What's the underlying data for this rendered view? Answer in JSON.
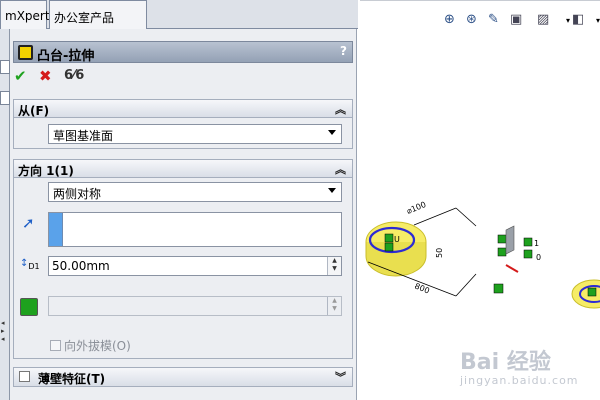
{
  "tabs": {
    "mxpert": "mXpert",
    "office": "办公室产品"
  },
  "feature": {
    "title": "凸台-拉伸",
    "help": "?"
  },
  "actions": {
    "ok": "✔",
    "cancel": "✖",
    "preview": "6⁄6"
  },
  "from_group": {
    "title": "从(F)",
    "value": "草图基准面"
  },
  "direction1": {
    "title": "方向 1(1)",
    "end_condition": "两侧对称",
    "depth": "50.00mm",
    "depth_icon_label": "D1",
    "draft_outward": "向外拔模(O)"
  },
  "thin_feature": {
    "title": "薄壁特征(T)"
  },
  "dimensions": {
    "dia": "⌀100",
    "width": "800",
    "small": "50"
  },
  "sketch_labels": {
    "u": "U",
    "l1": "1",
    "l0": "0"
  },
  "watermark": {
    "main": "Bai 经验",
    "sub": "jingyan.baidu.com"
  },
  "colors": {
    "header": "#94a1b5",
    "sketch_blue": "#2d2bd4",
    "extrude_yellow": "#f2e84a",
    "green_point": "#1ea11e"
  }
}
